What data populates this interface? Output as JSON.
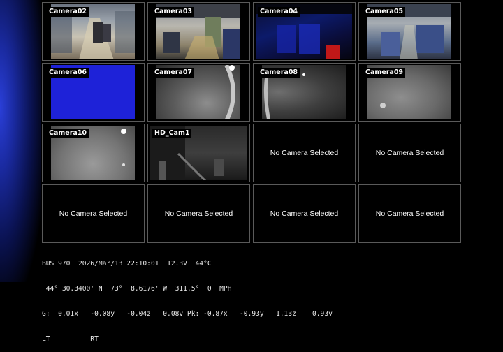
{
  "cameras": [
    {
      "label": "Camera02",
      "feed": "bus-interior"
    },
    {
      "label": "Camera03",
      "feed": "bus-interior"
    },
    {
      "label": "Camera04",
      "feed": "dark-blue"
    },
    {
      "label": "Camera05",
      "feed": "bus-interior"
    },
    {
      "label": "Camera06",
      "feed": "blue"
    },
    {
      "label": "Camera07",
      "feed": "grey"
    },
    {
      "label": "Camera08",
      "feed": "grey"
    },
    {
      "label": "Camera09",
      "feed": "grey"
    },
    {
      "label": "Camera10",
      "feed": "grey"
    },
    {
      "label": "HD_Cam1",
      "feed": "dark"
    }
  ],
  "empty_slot_text": "No Camera Selected",
  "status": {
    "line1": "BUS 970  2026/Mar/13 22:10:01  12.3V  44°C",
    "line2": " 44° 30.3400' N  73°  8.6176' W  311.5°  0  MPH",
    "line3": "G:  0.01x   -0.08y   -0.04z   0.08v Pk: -0.87x   -0.93y   1.13z    0.93v",
    "line4": "LT          RT"
  },
  "colors": {
    "background": "#000000",
    "cell_border": "#5a5a5a",
    "text": "#ffffff",
    "blue_feed": "#1e22d8"
  }
}
